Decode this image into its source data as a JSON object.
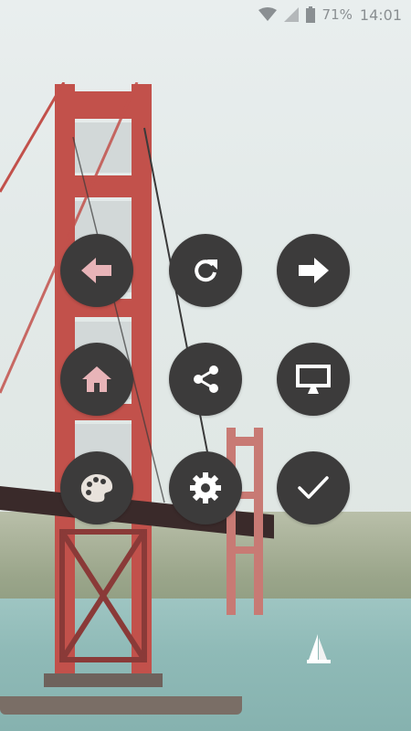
{
  "status_bar": {
    "battery_percent": "71%",
    "time": "14:01",
    "icons": [
      "wifi-icon",
      "cell-signal-icon",
      "battery-icon"
    ]
  },
  "buttons": [
    {
      "name": "back-button",
      "icon": "arrow-left-icon"
    },
    {
      "name": "refresh-button",
      "icon": "refresh-icon"
    },
    {
      "name": "forward-button",
      "icon": "arrow-right-icon"
    },
    {
      "name": "home-button",
      "icon": "home-icon"
    },
    {
      "name": "share-button",
      "icon": "share-icon"
    },
    {
      "name": "desktop-button",
      "icon": "monitor-icon"
    },
    {
      "name": "theme-button",
      "icon": "palette-icon"
    },
    {
      "name": "settings-button",
      "icon": "gear-icon"
    },
    {
      "name": "confirm-button",
      "icon": "checkmark-icon"
    }
  ],
  "colors": {
    "button_bg": "#3c3b3b",
    "icon": "#ffffff",
    "accent_pink": "#e8b4b8",
    "bridge_red": "#c14f4a"
  }
}
